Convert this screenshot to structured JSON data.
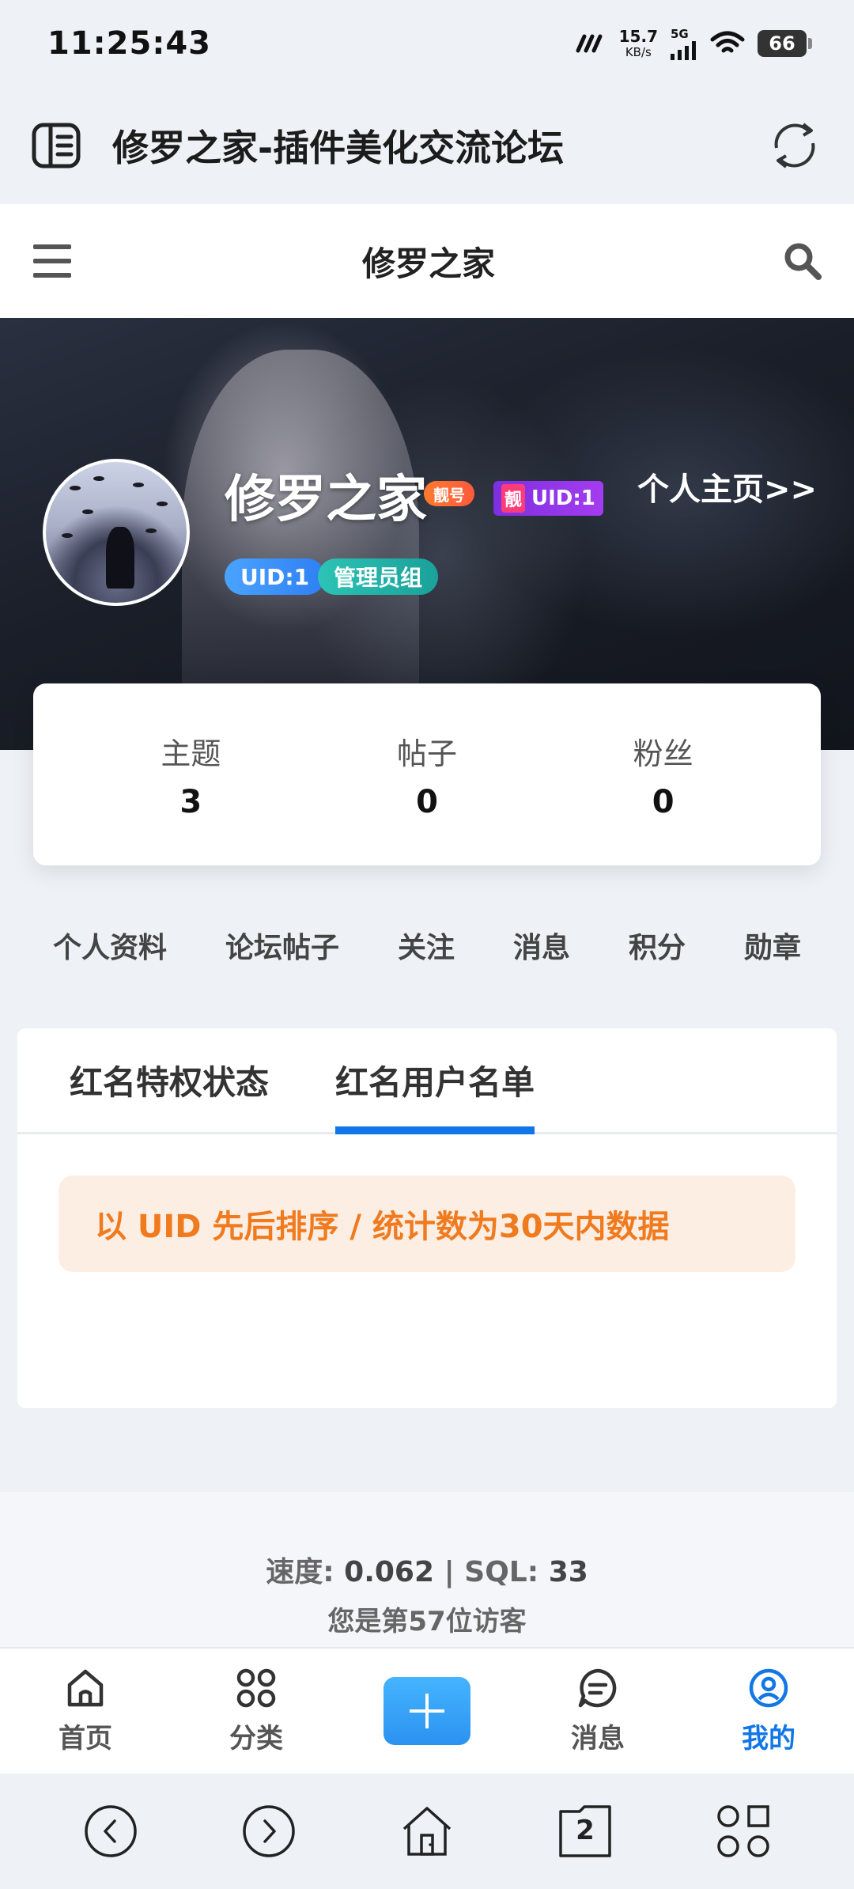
{
  "status_bar": {
    "time": "11:25:43",
    "net_speed_value": "15.7",
    "net_speed_unit": "KB/s",
    "network": "5G",
    "battery": "66"
  },
  "browser": {
    "title": "修罗之家-插件美化交流论坛"
  },
  "header": {
    "site_title": "修罗之家"
  },
  "profile": {
    "username": "修罗之家",
    "badge_liang": "靓号",
    "badge_liang_short": "靓",
    "badge_uid": "UID:1",
    "profile_link": "个人主页>>",
    "pill_uid": "UID:1",
    "pill_group": "管理员组"
  },
  "stats": [
    {
      "label": "主题",
      "value": "3"
    },
    {
      "label": "帖子",
      "value": "0"
    },
    {
      "label": "粉丝",
      "value": "0"
    }
  ],
  "nav_menu": [
    "个人资料",
    "论坛帖子",
    "关注",
    "消息",
    "积分",
    "勋章"
  ],
  "panel": {
    "tabs": [
      "红名特权状态",
      "红名用户名单"
    ],
    "active_tab": 1,
    "notice": "以 UID 先后排序 / 统计数为30天内数据"
  },
  "footer": {
    "speed_label": "速度:",
    "speed_value": "0.062",
    "sep": "|",
    "sql_label": "SQL:",
    "sql_value": "33",
    "visitor_text": "您是第57位访客"
  },
  "tabbar": [
    {
      "label": "首页",
      "icon": "home-icon"
    },
    {
      "label": "分类",
      "icon": "grid-icon"
    },
    {
      "label": "",
      "icon": "plus-icon"
    },
    {
      "label": "消息",
      "icon": "chat-icon"
    },
    {
      "label": "我的",
      "icon": "user-icon",
      "active": true
    }
  ],
  "sysnav": {
    "tab_count": "2"
  },
  "colors": {
    "accent": "#1277e6",
    "notice_text": "#f07a1e",
    "notice_bg": "#fdeee4"
  }
}
